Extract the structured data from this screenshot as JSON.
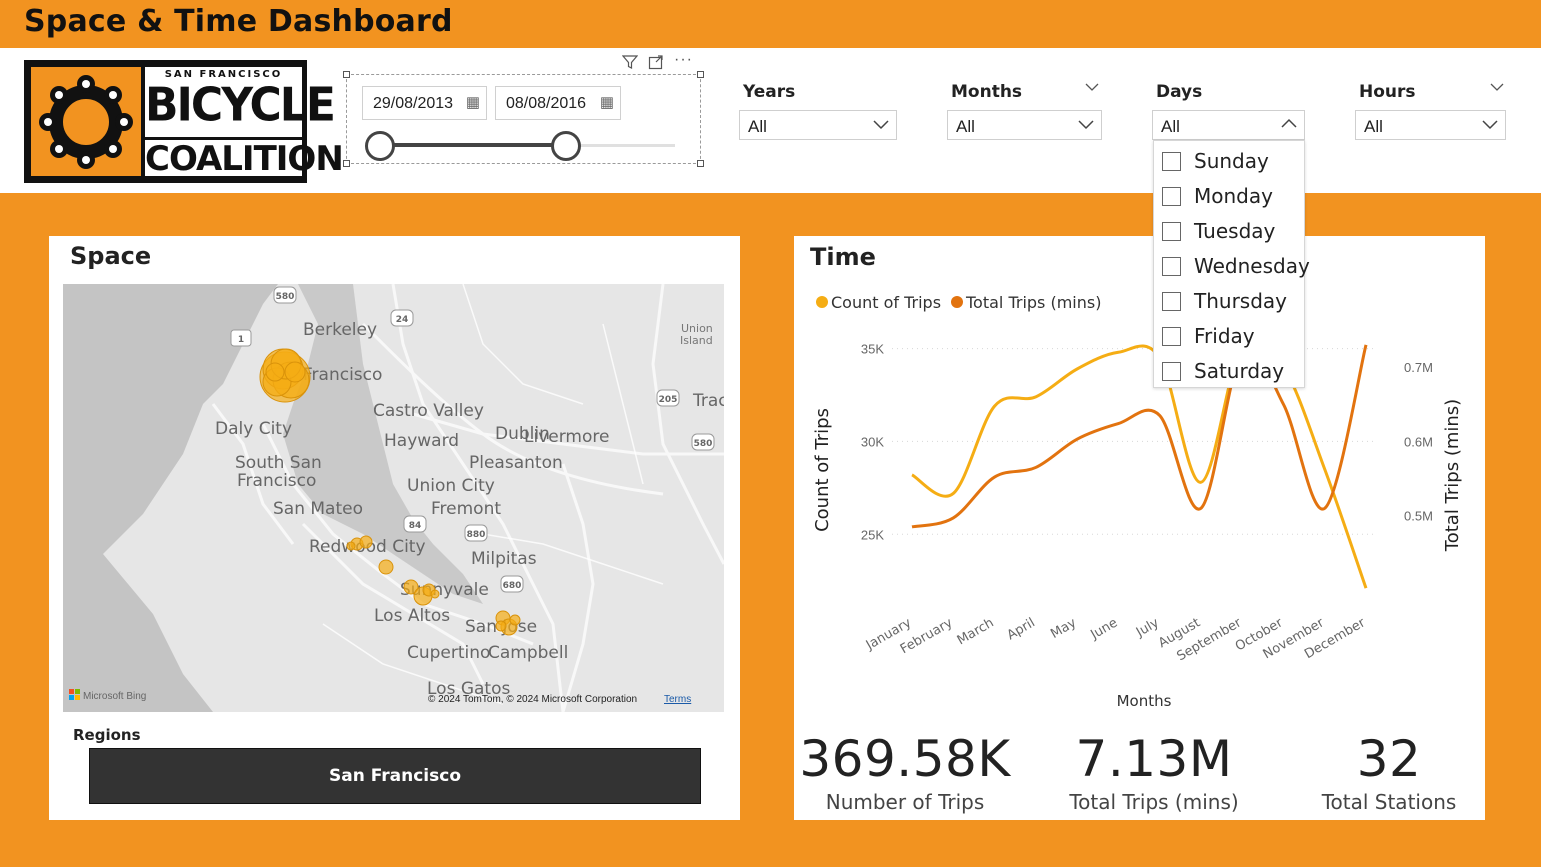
{
  "header": {
    "title": "Space & Time Dashboard"
  },
  "logo": {
    "line1": "SAN FRANCISCO",
    "line2": "BICYCLE",
    "line3": "COALITION"
  },
  "date_slicer": {
    "start": "29/08/2013",
    "end": "08/08/2016",
    "range_fraction": [
      0.0,
      0.63
    ]
  },
  "slicers": {
    "years": {
      "label": "Years",
      "value": "All"
    },
    "months": {
      "label": "Months",
      "value": "All"
    },
    "days": {
      "label": "Days",
      "value": "All",
      "options": [
        "Sunday",
        "Monday",
        "Tuesday",
        "Wednesday",
        "Thursday",
        "Friday",
        "Saturday"
      ]
    },
    "hours": {
      "label": "Hours",
      "value": "All"
    }
  },
  "space": {
    "title": "Space",
    "map_labels": [
      "Berkeley",
      "Francisco",
      "Castro Valley",
      "Daly City",
      "Hayward",
      "Dublin",
      "Livermore",
      "South San",
      "Francisco",
      "Pleasanton",
      "Union City",
      "San Mateo",
      "Fremont",
      "Redwood City",
      "Milpitas",
      "Sunnyvale",
      "Los Altos",
      "San Jose",
      "Cupertino",
      "Campbell",
      "Los Gatos",
      "Union",
      "Island",
      "Trac"
    ],
    "highway_shields": [
      "580",
      "24",
      "1",
      "205",
      "580",
      "84",
      "880",
      "680"
    ],
    "attribution": "© 2024 TomTom, © 2024 Microsoft Corporation",
    "terms": "Terms",
    "bing": "Microsoft Bing",
    "regions_label": "Regions",
    "region_selected": "San Francisco"
  },
  "time": {
    "title": "Time",
    "legend": [
      "Count of Trips",
      "Total Trips (mins)"
    ],
    "colors": {
      "count": "#f5ad14",
      "total": "#e2730f"
    }
  },
  "chart_data": {
    "type": "line",
    "categories": [
      "January",
      "February",
      "March",
      "April",
      "May",
      "June",
      "July",
      "August",
      "September",
      "October",
      "November",
      "December"
    ],
    "xlabel": "Months",
    "ylabel": "Count of Trips",
    "y2label": "Total Trips (mins)",
    "ylim": [
      22000,
      36000
    ],
    "y2lim": [
      0.4,
      0.75
    ],
    "yticks": [
      "35K",
      "30K",
      "25K"
    ],
    "y2ticks": [
      "0.7M",
      "0.6M",
      "0.5M"
    ],
    "series": [
      {
        "name": "Count of Trips",
        "axis": "left",
        "values": [
          28200,
          27200,
          31900,
          32400,
          33900,
          34800,
          34500,
          27800,
          35200,
          34000,
          28500,
          22100
        ]
      },
      {
        "name": "Total Trips (mins)",
        "axis": "right",
        "values": [
          0.485,
          0.497,
          0.552,
          0.565,
          0.603,
          0.624,
          0.635,
          0.51,
          0.72,
          0.65,
          0.51,
          0.73
        ]
      }
    ]
  },
  "kpis": [
    {
      "value": "369.58K",
      "label": "Number of Trips"
    },
    {
      "value": "7.13M",
      "label": "Total Trips (mins)"
    },
    {
      "value": "32",
      "label": "Total Stations"
    }
  ]
}
